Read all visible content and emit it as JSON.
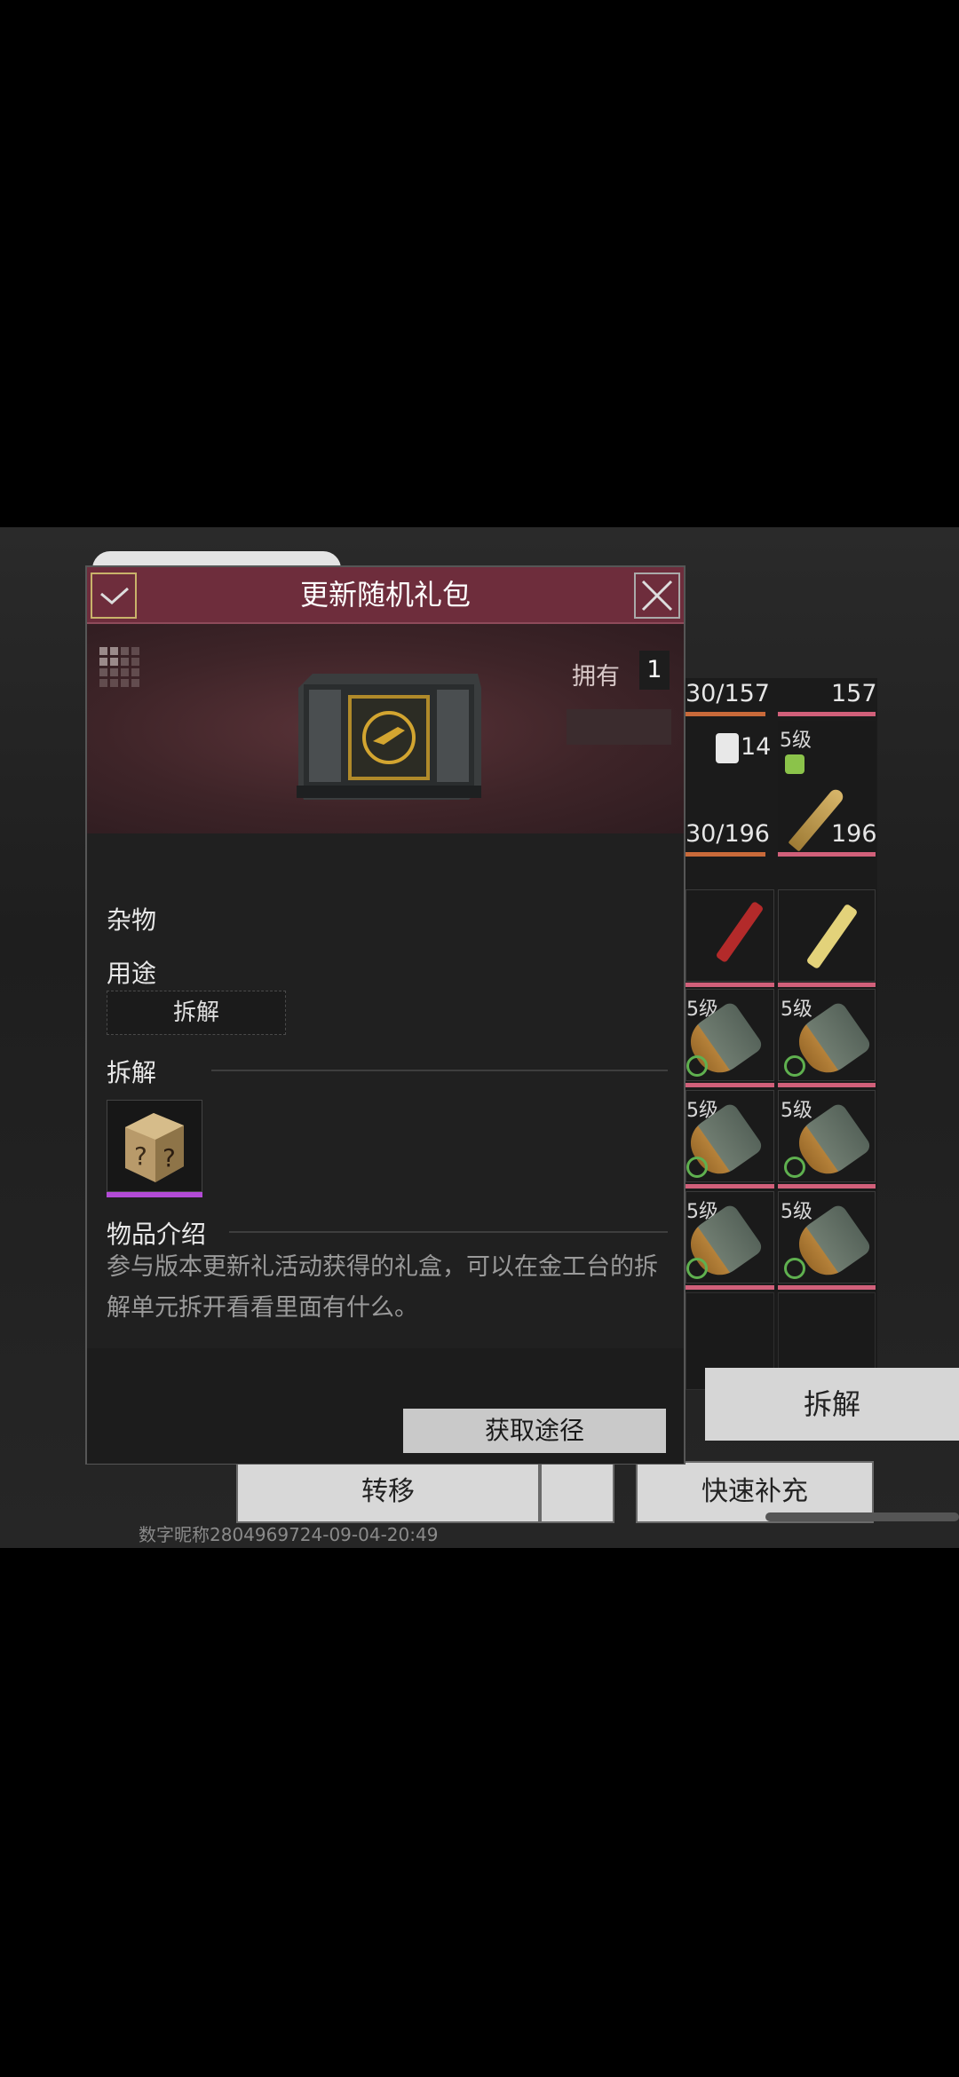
{
  "dialog": {
    "title": "更新随机礼包",
    "own_label": "拥有",
    "own_count": "1",
    "category": "杂物",
    "usage_label": "用途",
    "usage_button": "拆解",
    "dismantle_label": "拆解",
    "intro_label": "物品介绍",
    "description": "参与版本更新礼活动获得的礼盒，可以在金工台的拆解单元拆开看看里面有什么。",
    "acquire_button": "获取途径",
    "icons": {
      "confirm": "check-icon",
      "close": "close-icon",
      "grid": "grid-icon",
      "item": "supply-crate-icon",
      "dismantle_result": "mystery-dice-icon"
    }
  },
  "background": {
    "ammo_row_top_left": "30/157",
    "ammo_row_top_right": "157",
    "ammo_count_badge": "14",
    "ammo_left_total": "30/196",
    "ammo_right_level": "5级",
    "ammo_right_total": "196",
    "grid_levels": [
      "5级",
      "5级",
      "5级",
      "5级",
      "5级",
      "5级"
    ],
    "transfer_button": "转移",
    "quick_refill_button": "快速补充"
  },
  "dismantle_button": "拆解",
  "watermark": "数字昵称2804969724-09-04-20:49",
  "colors": {
    "header": "#6e2d3c",
    "banner": "#3e2428",
    "rarity_purple": "#b34bd6",
    "slot_pink": "#d1607a",
    "gold_border": "#c9b36a"
  }
}
